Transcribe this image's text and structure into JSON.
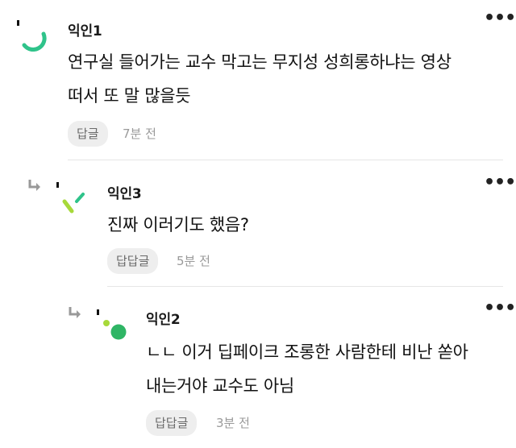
{
  "comments": [
    {
      "author": "익인1",
      "text_lines": [
        "연구실 들어가는 교수 막고는 무지성 성희롱하냐는 영상",
        "떠서 또 말 많을듯"
      ],
      "reply_label": "답글",
      "time": "7분 전",
      "avatar_color": "#2fc38a"
    },
    {
      "author": "익인3",
      "text_lines": [
        "진짜 이러기도 했음?"
      ],
      "reply_label": "답답글",
      "time": "5분 전",
      "avatar_color": "#a7d93a"
    },
    {
      "author": "익인2",
      "text_lines": [
        "ㄴㄴ 이거 딥페이크 조롱한 사람한테 비난 쏟아",
        "내는거야 교수도 아님"
      ],
      "reply_label": "답답글",
      "time": "3분 전",
      "avatar_color": "#2fb565"
    }
  ],
  "more_label": "•••",
  "icons": {
    "reply_indent": "reply-arrow-icon",
    "more": "more-dots-icon"
  }
}
